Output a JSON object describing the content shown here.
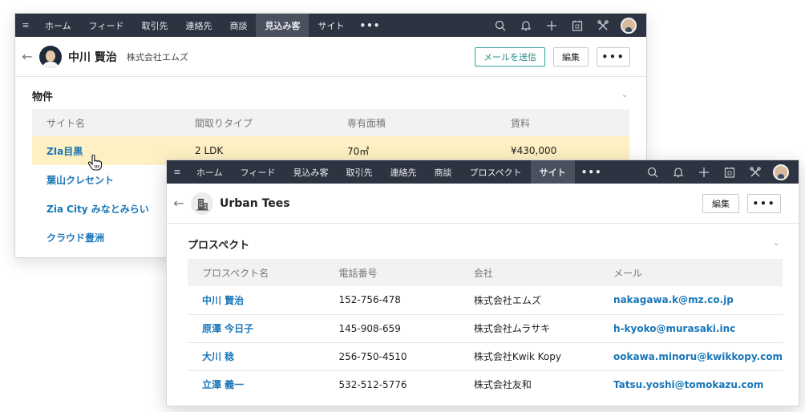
{
  "win1": {
    "nav": {
      "tabs": [
        "ホーム",
        "フィード",
        "取引先",
        "連絡先",
        "商談",
        "見込み客",
        "サイト"
      ],
      "active": "見込み客",
      "more": "•••",
      "icons": [
        "search-icon",
        "bell-icon",
        "plus-icon",
        "calendar-icon",
        "tools-icon",
        "user-avatar"
      ]
    },
    "header": {
      "back": "←",
      "name": "中川 賢治",
      "company": "株式会社エムズ",
      "send_mail": "メールを送信",
      "edit": "編集",
      "more": "•••"
    },
    "section": {
      "title": "物件",
      "columns": [
        "サイト名",
        "間取りタイプ",
        "専有面積",
        "賃料"
      ],
      "rows": [
        [
          "ZIa目黒",
          "2 LDK",
          "70㎡",
          "¥430,000"
        ],
        [
          "葉山クレセント",
          "",
          "",
          ""
        ],
        [
          "Zia City みなとみらい",
          "",
          "",
          ""
        ],
        [
          "クラウド豊洲",
          "",
          "",
          ""
        ]
      ]
    }
  },
  "win2": {
    "nav": {
      "tabs": [
        "ホーム",
        "フィード",
        "見込み客",
        "取引先",
        "連絡先",
        "商談",
        "プロスペクト",
        "サイト"
      ],
      "active": "サイト",
      "more": "•••",
      "icons": [
        "search-icon",
        "bell-icon",
        "plus-icon",
        "calendar-icon",
        "tools-icon",
        "user-avatar"
      ]
    },
    "header": {
      "back": "←",
      "name": "Urban Tees",
      "edit": "編集",
      "more": "•••"
    },
    "section": {
      "title": "プロスペクト",
      "columns": [
        "プロスペクト名",
        "電話番号",
        "会社",
        "メール"
      ],
      "rows": [
        [
          "中川 賢治",
          "152-756-478",
          "株式会社エムズ",
          "nakagawa.k@mz.co.jp"
        ],
        [
          "原澤 今日子",
          "145-908-659",
          "株式会社ムラサキ",
          "h-kyoko@murasaki.inc"
        ],
        [
          "大川 稔",
          "256-750-4510",
          "株式会社Kwik Kopy",
          "ookawa.minoru@kwikkopy.com"
        ],
        [
          "立澤 義一",
          "532-512-5776",
          "株式会社友和",
          "Tatsu.yoshi@tomokazu.com"
        ]
      ]
    }
  },
  "colors": {
    "nav_bg": "#2d3340",
    "nav_active": "#4a505d",
    "link": "#1976b8",
    "highlight_row": "#fdf0c2",
    "primary_button_border": "#2fa39a"
  }
}
